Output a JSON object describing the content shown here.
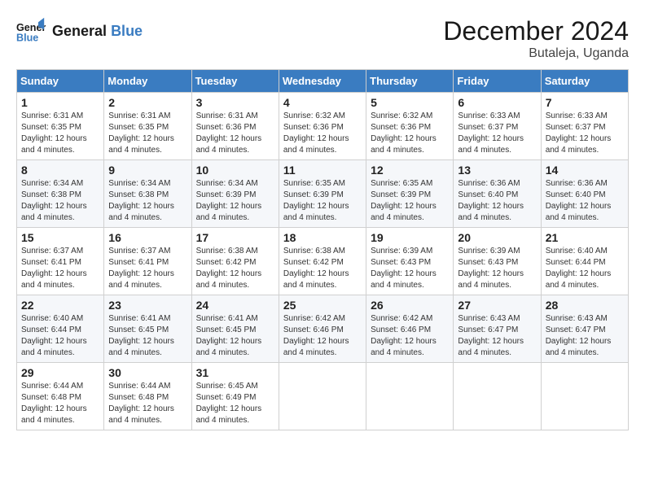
{
  "header": {
    "logo_line1": "General",
    "logo_line2": "Blue",
    "month": "December 2024",
    "location": "Butaleja, Uganda"
  },
  "days_of_week": [
    "Sunday",
    "Monday",
    "Tuesday",
    "Wednesday",
    "Thursday",
    "Friday",
    "Saturday"
  ],
  "weeks": [
    [
      {
        "day": "1",
        "sunrise": "6:31 AM",
        "sunset": "6:35 PM",
        "daylight": "12 hours and 4 minutes."
      },
      {
        "day": "2",
        "sunrise": "6:31 AM",
        "sunset": "6:35 PM",
        "daylight": "12 hours and 4 minutes."
      },
      {
        "day": "3",
        "sunrise": "6:31 AM",
        "sunset": "6:36 PM",
        "daylight": "12 hours and 4 minutes."
      },
      {
        "day": "4",
        "sunrise": "6:32 AM",
        "sunset": "6:36 PM",
        "daylight": "12 hours and 4 minutes."
      },
      {
        "day": "5",
        "sunrise": "6:32 AM",
        "sunset": "6:36 PM",
        "daylight": "12 hours and 4 minutes."
      },
      {
        "day": "6",
        "sunrise": "6:33 AM",
        "sunset": "6:37 PM",
        "daylight": "12 hours and 4 minutes."
      },
      {
        "day": "7",
        "sunrise": "6:33 AM",
        "sunset": "6:37 PM",
        "daylight": "12 hours and 4 minutes."
      }
    ],
    [
      {
        "day": "8",
        "sunrise": "6:34 AM",
        "sunset": "6:38 PM",
        "daylight": "12 hours and 4 minutes."
      },
      {
        "day": "9",
        "sunrise": "6:34 AM",
        "sunset": "6:38 PM",
        "daylight": "12 hours and 4 minutes."
      },
      {
        "day": "10",
        "sunrise": "6:34 AM",
        "sunset": "6:39 PM",
        "daylight": "12 hours and 4 minutes."
      },
      {
        "day": "11",
        "sunrise": "6:35 AM",
        "sunset": "6:39 PM",
        "daylight": "12 hours and 4 minutes."
      },
      {
        "day": "12",
        "sunrise": "6:35 AM",
        "sunset": "6:39 PM",
        "daylight": "12 hours and 4 minutes."
      },
      {
        "day": "13",
        "sunrise": "6:36 AM",
        "sunset": "6:40 PM",
        "daylight": "12 hours and 4 minutes."
      },
      {
        "day": "14",
        "sunrise": "6:36 AM",
        "sunset": "6:40 PM",
        "daylight": "12 hours and 4 minutes."
      }
    ],
    [
      {
        "day": "15",
        "sunrise": "6:37 AM",
        "sunset": "6:41 PM",
        "daylight": "12 hours and 4 minutes."
      },
      {
        "day": "16",
        "sunrise": "6:37 AM",
        "sunset": "6:41 PM",
        "daylight": "12 hours and 4 minutes."
      },
      {
        "day": "17",
        "sunrise": "6:38 AM",
        "sunset": "6:42 PM",
        "daylight": "12 hours and 4 minutes."
      },
      {
        "day": "18",
        "sunrise": "6:38 AM",
        "sunset": "6:42 PM",
        "daylight": "12 hours and 4 minutes."
      },
      {
        "day": "19",
        "sunrise": "6:39 AM",
        "sunset": "6:43 PM",
        "daylight": "12 hours and 4 minutes."
      },
      {
        "day": "20",
        "sunrise": "6:39 AM",
        "sunset": "6:43 PM",
        "daylight": "12 hours and 4 minutes."
      },
      {
        "day": "21",
        "sunrise": "6:40 AM",
        "sunset": "6:44 PM",
        "daylight": "12 hours and 4 minutes."
      }
    ],
    [
      {
        "day": "22",
        "sunrise": "6:40 AM",
        "sunset": "6:44 PM",
        "daylight": "12 hours and 4 minutes."
      },
      {
        "day": "23",
        "sunrise": "6:41 AM",
        "sunset": "6:45 PM",
        "daylight": "12 hours and 4 minutes."
      },
      {
        "day": "24",
        "sunrise": "6:41 AM",
        "sunset": "6:45 PM",
        "daylight": "12 hours and 4 minutes."
      },
      {
        "day": "25",
        "sunrise": "6:42 AM",
        "sunset": "6:46 PM",
        "daylight": "12 hours and 4 minutes."
      },
      {
        "day": "26",
        "sunrise": "6:42 AM",
        "sunset": "6:46 PM",
        "daylight": "12 hours and 4 minutes."
      },
      {
        "day": "27",
        "sunrise": "6:43 AM",
        "sunset": "6:47 PM",
        "daylight": "12 hours and 4 minutes."
      },
      {
        "day": "28",
        "sunrise": "6:43 AM",
        "sunset": "6:47 PM",
        "daylight": "12 hours and 4 minutes."
      }
    ],
    [
      {
        "day": "29",
        "sunrise": "6:44 AM",
        "sunset": "6:48 PM",
        "daylight": "12 hours and 4 minutes."
      },
      {
        "day": "30",
        "sunrise": "6:44 AM",
        "sunset": "6:48 PM",
        "daylight": "12 hours and 4 minutes."
      },
      {
        "day": "31",
        "sunrise": "6:45 AM",
        "sunset": "6:49 PM",
        "daylight": "12 hours and 4 minutes."
      },
      null,
      null,
      null,
      null
    ]
  ]
}
